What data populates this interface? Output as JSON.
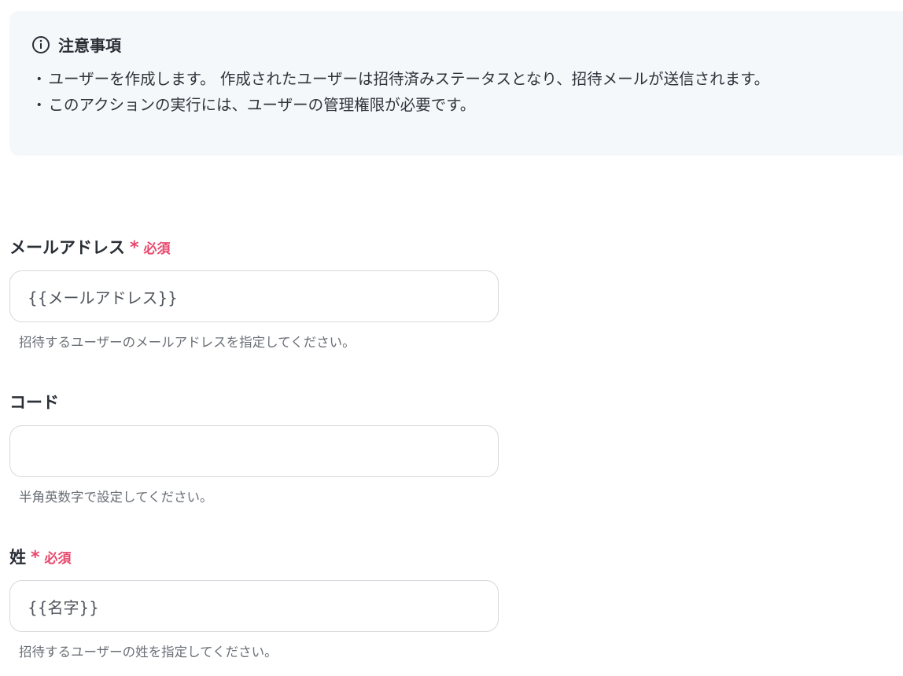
{
  "notice": {
    "title": "注意事項",
    "icon": "info-icon",
    "items": [
      "ユーザーを作成します。 作成されたユーザーは招待済みステータスとなり、招待メールが送信されます。",
      "このアクションの実行には、ユーザーの管理権限が必要です。"
    ],
    "bullet": "・"
  },
  "required_mark": {
    "star": "*",
    "text": "必須",
    "color": "#e8486d"
  },
  "fields": [
    {
      "label": "メールアドレス",
      "required": true,
      "value": "{{メールアドレス}}",
      "help": "招待するユーザーのメールアドレスを指定してください。"
    },
    {
      "label": "コード",
      "required": false,
      "value": "",
      "help": "半角英数字で設定してください。"
    },
    {
      "label": "姓",
      "required": true,
      "value": "{{名字}}",
      "help": "招待するユーザーの姓を指定してください。"
    }
  ]
}
